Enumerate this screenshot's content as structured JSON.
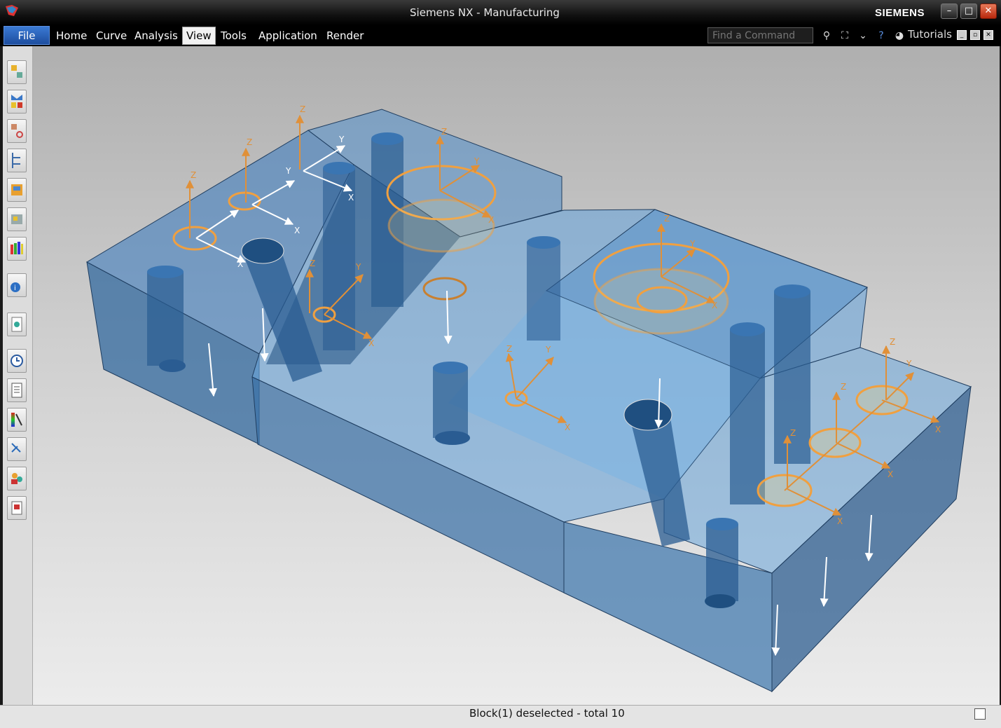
{
  "window": {
    "title": "Siemens NX - Manufacturing",
    "brand": "SIEMENS",
    "controls": [
      "minimize",
      "maximize",
      "close"
    ]
  },
  "menu": {
    "file": "File",
    "items": [
      {
        "label": "Home"
      },
      {
        "label": "Curve"
      },
      {
        "label": "Analysis"
      },
      {
        "label": "View",
        "active": true
      },
      {
        "label": "Tools"
      },
      {
        "label": "Application"
      },
      {
        "label": "Render"
      }
    ],
    "search_placeholder": "Find a Command",
    "tutorials": "Tutorials"
  },
  "sidebar": {
    "tools": [
      "operation-navigator-icon",
      "machine-tool-icon",
      "part-navigator-icon",
      "assembly-navigator-icon",
      "reuse-library-icon",
      "hd3d-tools-icon",
      "palette-icon",
      "info-icon",
      "web-browser-icon",
      "history-icon",
      "process-navigator-icon",
      "visualization-icon",
      "constraint-navigator-icon",
      "roles-icon",
      "system-materials-icon"
    ]
  },
  "viewport": {
    "axis_labels": {
      "x": "X",
      "y": "Y",
      "z": "Z"
    },
    "colors": {
      "block": "#2f6aa6",
      "accent": "#f0a040",
      "highlight": "#ffffff"
    }
  },
  "status": {
    "message": "Block(1) deselected - total 10"
  }
}
